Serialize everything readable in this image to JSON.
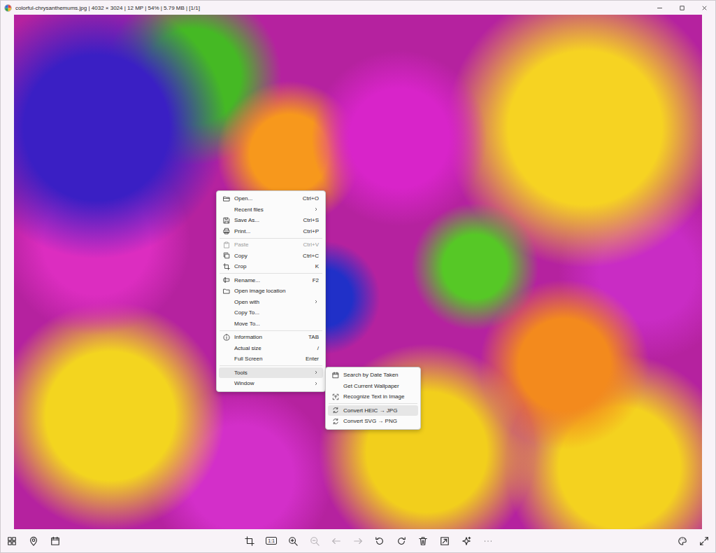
{
  "window": {
    "title": "colorful-chrysanthemums.jpg | 4032 × 3024 | 12 MP | 54% | 5.79 MB | [1/1]"
  },
  "context_menu": {
    "items": [
      {
        "kind": "item",
        "label": "Open...",
        "shortcut": "Ctrl+O",
        "submenu": false,
        "disabled": false,
        "selected": false
      },
      {
        "kind": "item",
        "label": "Recent files",
        "submenu": true,
        "disabled": false,
        "selected": false
      },
      {
        "kind": "item",
        "label": "Save As...",
        "shortcut": "Ctrl+S",
        "submenu": false,
        "disabled": false,
        "selected": false
      },
      {
        "kind": "item",
        "label": "Print...",
        "shortcut": "Ctrl+P",
        "submenu": false,
        "disabled": false,
        "selected": false
      },
      {
        "kind": "separator"
      },
      {
        "kind": "item",
        "label": "Paste",
        "shortcut": "Ctrl+V",
        "submenu": false,
        "disabled": true,
        "selected": false
      },
      {
        "kind": "item",
        "label": "Copy",
        "shortcut": "Ctrl+C",
        "submenu": false,
        "disabled": false,
        "selected": false
      },
      {
        "kind": "item",
        "label": "Crop",
        "shortcut": "K",
        "submenu": false,
        "disabled": false,
        "selected": false
      },
      {
        "kind": "separator"
      },
      {
        "kind": "item",
        "label": "Rename...",
        "shortcut": "F2",
        "submenu": false,
        "disabled": false,
        "selected": false
      },
      {
        "kind": "item",
        "label": "Open image location",
        "submenu": false,
        "disabled": false,
        "selected": false
      },
      {
        "kind": "item",
        "label": "Open with",
        "submenu": true,
        "disabled": false,
        "selected": false
      },
      {
        "kind": "item",
        "label": "Copy To...",
        "submenu": false,
        "disabled": false,
        "selected": false
      },
      {
        "kind": "item",
        "label": "Move To...",
        "submenu": false,
        "disabled": false,
        "selected": false
      },
      {
        "kind": "separator"
      },
      {
        "kind": "item",
        "label": "Information",
        "shortcut": "TAB",
        "submenu": false,
        "disabled": false,
        "selected": false
      },
      {
        "kind": "item",
        "label": "Actual size",
        "shortcut": "/",
        "submenu": false,
        "disabled": false,
        "selected": false
      },
      {
        "kind": "item",
        "label": "Full Screen",
        "shortcut": "Enter",
        "submenu": false,
        "disabled": false,
        "selected": false
      },
      {
        "kind": "separator"
      },
      {
        "kind": "item",
        "label": "Tools",
        "submenu": true,
        "disabled": false,
        "selected": true
      },
      {
        "kind": "item",
        "label": "Window",
        "submenu": true,
        "disabled": false,
        "selected": false
      }
    ]
  },
  "tools_submenu": {
    "items": [
      {
        "kind": "item",
        "label": "Search by Date Taken",
        "selected": false
      },
      {
        "kind": "item",
        "label": "Get Current Wallpaper",
        "selected": false
      },
      {
        "kind": "item",
        "label": "Recognize Text in Image",
        "selected": false
      },
      {
        "kind": "separator"
      },
      {
        "kind": "item",
        "label": "Convert HEIC → JPG",
        "selected": true
      },
      {
        "kind": "item",
        "label": "Convert SVG → PNG",
        "selected": false
      }
    ]
  },
  "toolbar": {
    "left": [
      {
        "disabled": false
      },
      {
        "disabled": false
      },
      {
        "disabled": false
      }
    ],
    "center": [
      {
        "disabled": false
      },
      {
        "label": "1:1",
        "disabled": false
      },
      {
        "disabled": false
      },
      {
        "disabled": true
      },
      {
        "disabled": true
      },
      {
        "disabled": true
      },
      {
        "disabled": false
      },
      {
        "disabled": false
      },
      {
        "disabled": false
      },
      {
        "disabled": false
      },
      {
        "disabled": false
      },
      {
        "disabled": false
      }
    ],
    "right": [
      {
        "disabled": false
      },
      {
        "disabled": false
      }
    ]
  }
}
